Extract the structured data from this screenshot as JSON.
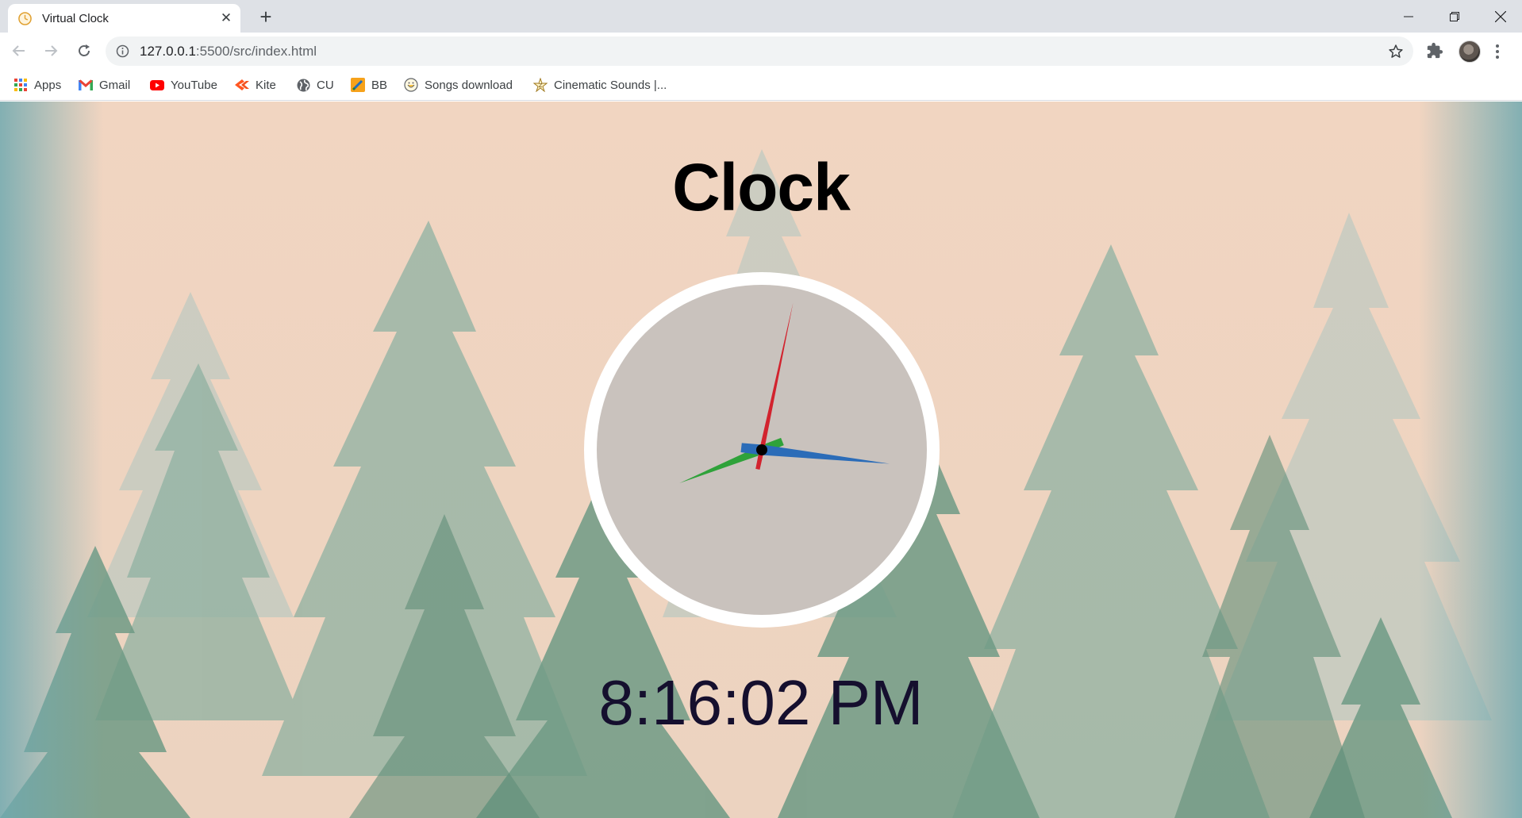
{
  "browser": {
    "tab": {
      "title": "Virtual Clock",
      "close_glyph": "✕",
      "favicon": "clock-favicon-icon"
    },
    "new_tab_glyph": "+",
    "window_controls": {
      "minimize": "minimize-icon",
      "maximize": "restore-icon",
      "close": "close-icon"
    },
    "address": {
      "host": "127.0.0.1",
      "path": ":5500/src/index.html"
    },
    "bookmarks": [
      {
        "label": "Apps",
        "icon": "apps-grid-icon"
      },
      {
        "label": "Gmail",
        "icon": "gmail-icon"
      },
      {
        "label": "YouTube",
        "icon": "youtube-icon"
      },
      {
        "label": "Kite",
        "icon": "kite-icon"
      },
      {
        "label": "CU",
        "icon": "globe-icon"
      },
      {
        "label": "BB",
        "icon": "bb-icon"
      },
      {
        "label": "Songs download",
        "icon": "songs-icon"
      },
      {
        "label": "Cinematic Sounds |...",
        "icon": "cinematic-icon"
      }
    ]
  },
  "page": {
    "title": "Clock",
    "time": {
      "hours": 8,
      "minutes": 16,
      "seconds": 2
    },
    "digital_time": "8:16:02 PM",
    "colors": {
      "hour_hand": "#2fa23a",
      "minute_hand": "#2b6cb8",
      "second_hand": "#d2232e",
      "clock_face": "#c9c2bd",
      "clock_ring": "#ffffff",
      "background": "#f1d7c5"
    }
  }
}
